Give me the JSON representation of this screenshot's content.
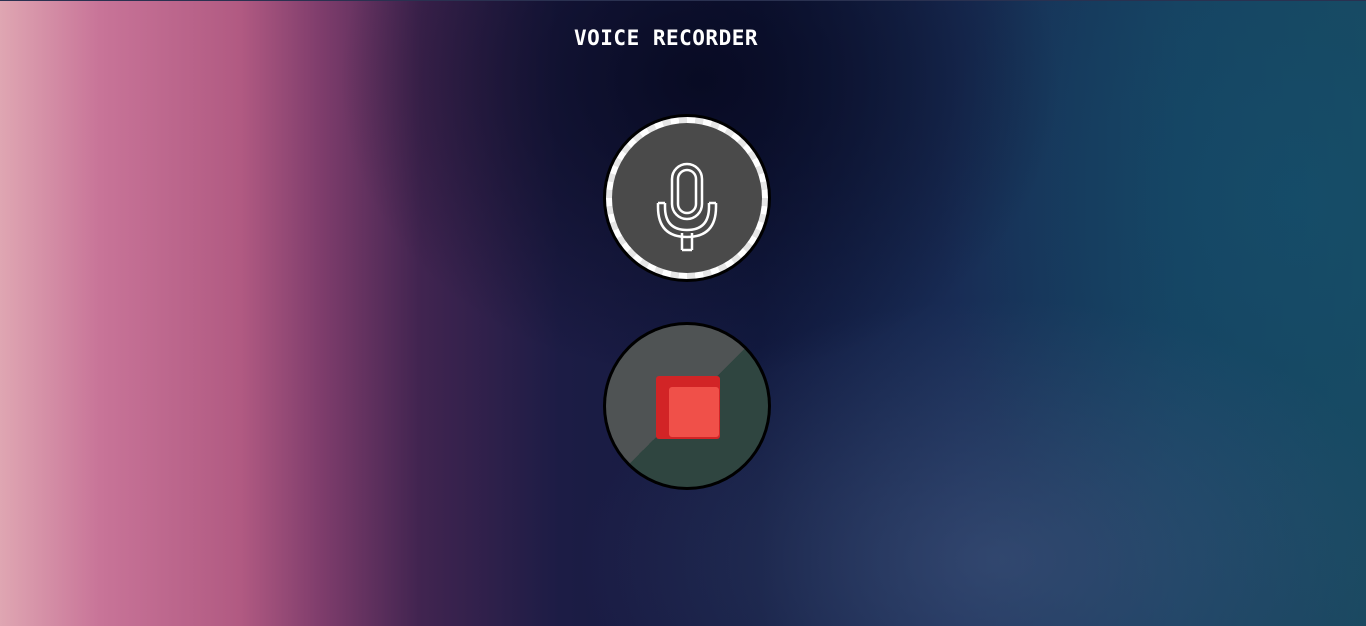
{
  "app": {
    "title": "VOICE RECORDER"
  },
  "controls": {
    "record": {
      "icon": "microphone-icon"
    },
    "stop": {
      "icon": "stop-square-icon",
      "colors": {
        "back": "#d22426",
        "front": "#f05049"
      }
    }
  }
}
